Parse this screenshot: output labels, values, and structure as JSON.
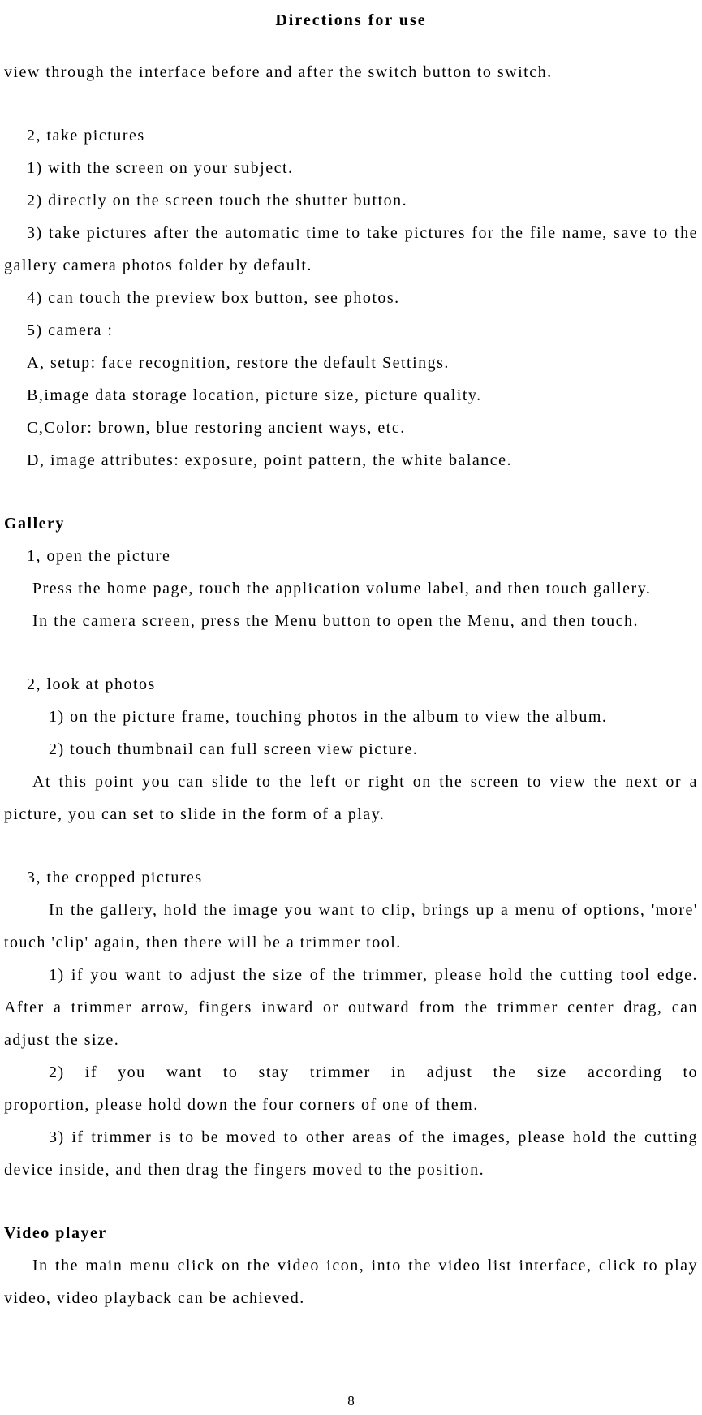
{
  "header": {
    "title": "Directions for use"
  },
  "body": {
    "intro": "view through the interface before and after the switch button to switch.",
    "s2_title": "2, take pictures",
    "s2_1": "1) with the screen on your subject.",
    "s2_2": "2) directly on the screen touch the shutter button.",
    "s2_3": "3) take pictures after the automatic time to take pictures for the file name, save to the gallery camera photos folder by default.",
    "s2_4": "4) can touch the preview box button, see photos.",
    "s2_5": "5) camera :",
    "s2_a": "A, setup: face recognition, restore the default Settings.",
    "s2_b": "B,image data storage location, picture size, picture quality.",
    "s2_c": "C,Color: brown, blue restoring ancient ways, etc.",
    "s2_d": "D, image attributes: exposure, point pattern, the white balance.",
    "gallery_title": "Gallery",
    "g1_title": "1, open the picture",
    "g1_p1": "Press the home page, touch the application volume label, and then touch gallery.",
    "g1_p2": "In the camera screen, press the Menu button to open the Menu, and then touch.",
    "g2_title": "2, look at photos",
    "g2_1": "1) on the picture frame, touching photos in the album to view the album.",
    "g2_2": "2) touch thumbnail can full screen view picture.",
    "g2_p": "At this point you can slide to the left or right on the screen to view the next or a picture, you can set to slide in the form of a play.",
    "g3_title": "3, the cropped pictures",
    "g3_p": "In the gallery, hold the image you want to clip, brings up a menu of options, 'more' touch 'clip' again, then there will be a trimmer tool.",
    "g3_1": "1) if you want to adjust the size of the trimmer, please hold the cutting tool edge. After a trimmer arrow, fingers inward or outward from the trimmer center drag, can adjust the size.",
    "g3_2": "2) if you want to stay trimmer in adjust the size according to proportion, please hold down the four corners of one of them.",
    "g3_3": "3) if trimmer is to be moved to other areas of the images, please hold the cutting device inside, and then drag the fingers moved to the position.",
    "vp_title": "Video player",
    "vp_p": "In the main menu click on the video icon, into the video list interface, click to play video, video playback can be achieved."
  },
  "page_number": "8"
}
